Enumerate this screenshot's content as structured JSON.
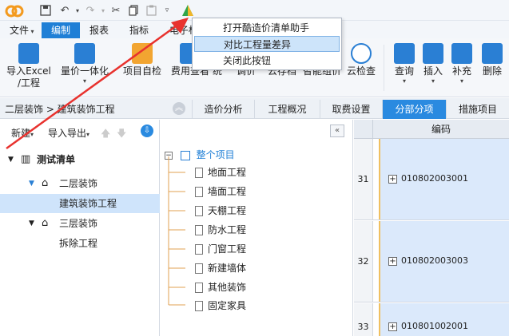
{
  "menus": {
    "file": "文件",
    "edit": "编制",
    "report": "报表",
    "index": "指标",
    "electronic": "电子标"
  },
  "ribbon": {
    "import_excel_l1": "导入Excel",
    "import_excel_l2": "/工程",
    "price_integration": "量价一体化",
    "self_check": "项目自检",
    "fee_check": "费用查看",
    "fragment1": "统",
    "fragment2": "调价",
    "cloud_report": "云存档",
    "smart_assembly": "智能组价",
    "cloud_check": "云检查",
    "query": "查询",
    "insert": "插入",
    "supplement": "补充",
    "delete": "删除"
  },
  "dropdown": {
    "items": [
      "打开酷造价清单助手",
      "对比工程量差异",
      "关闭此按钮"
    ]
  },
  "breadcrumb": "二层装饰 > 建筑装饰工程",
  "view_tabs": [
    "造价分析",
    "工程概况",
    "取费设置",
    "分部分项",
    "措施项目"
  ],
  "left_toolbar": {
    "new": "新建",
    "import_export": "导入导出"
  },
  "tree": {
    "root": "测试清单",
    "n1": "二层装饰",
    "n1_child": "建筑装饰工程",
    "n2": "三层装饰",
    "n2_child": "拆除工程"
  },
  "mid": {
    "root": "整个项目",
    "items": [
      "地面工程",
      "墙面工程",
      "天棚工程",
      "防水工程",
      "门窗工程",
      "新建墙体",
      "其他装饰",
      "固定家具"
    ]
  },
  "grid": {
    "header": "编码",
    "rows": [
      {
        "num": "31",
        "code": "010802003001"
      },
      {
        "num": "32",
        "code": "010802003003"
      },
      {
        "num": "33",
        "code": "010801002001"
      }
    ]
  },
  "colors": {
    "accent": "#1f7fd6",
    "selection": "#cfe4fb",
    "arrow": "#e8322e"
  }
}
